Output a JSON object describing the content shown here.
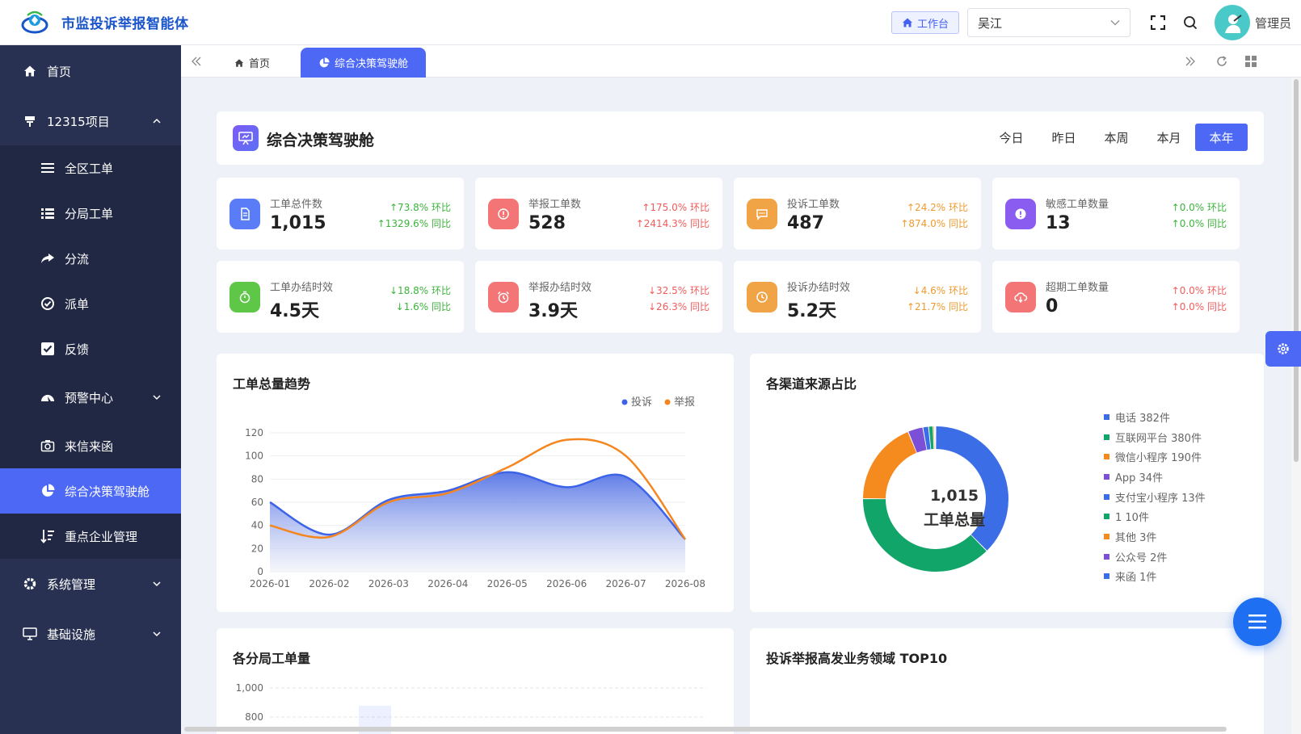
{
  "app": {
    "title": "市监投诉举报智能体"
  },
  "topbar": {
    "workspace_label": "工作台",
    "region_value": "吴江",
    "user_name": "管理员"
  },
  "sidebar": {
    "items": [
      {
        "label": "首页",
        "icon": "home-icon"
      },
      {
        "label": "12315项目",
        "icon": "flag-icon",
        "expanded": true
      },
      {
        "label": "全区工单",
        "icon": "list-icon"
      },
      {
        "label": "分局工单",
        "icon": "grid-list-icon"
      },
      {
        "label": "分流",
        "icon": "share-icon"
      },
      {
        "label": "派单",
        "icon": "check-circle-icon"
      },
      {
        "label": "反馈",
        "icon": "checkbox-icon"
      },
      {
        "label": "预警中心",
        "icon": "dashboard-icon"
      },
      {
        "label": "来信来函",
        "icon": "camera-icon"
      },
      {
        "label": "综合决策驾驶舱",
        "icon": "pie-icon",
        "active": true
      },
      {
        "label": "重点企业管理",
        "icon": "sort-icon"
      },
      {
        "label": "系统管理",
        "icon": "gear-icon"
      },
      {
        "label": "基础设施",
        "icon": "monitor-icon"
      }
    ]
  },
  "tabs": [
    {
      "label": "首页",
      "icon": "home-icon"
    },
    {
      "label": "综合决策驾驶舱",
      "icon": "pie-icon",
      "active": true
    }
  ],
  "dashboard": {
    "title": "综合决策驾驶舱",
    "periods": [
      "今日",
      "昨日",
      "本周",
      "本月",
      "本年"
    ],
    "active_period": "本年"
  },
  "stats": [
    {
      "label": "工单总件数",
      "value": "1,015",
      "mom": "↑73.8% 环比",
      "yoy": "↑1329.6% 同比",
      "icon": "document-icon",
      "icon_color": "#5b7cf7",
      "delta_color": "#3cb33c"
    },
    {
      "label": "举报工单数",
      "value": "528",
      "mom": "↑175.0% 环比",
      "yoy": "↑2414.3% 同比",
      "icon": "alert-circle-icon",
      "icon_color": "#f37575",
      "delta_color": "#ef5c5c"
    },
    {
      "label": "投诉工单数",
      "value": "487",
      "mom": "↑24.2% 环比",
      "yoy": "↑874.0% 同比",
      "icon": "chat-icon",
      "icon_color": "#f1a445",
      "delta_color": "#ef9a2e"
    },
    {
      "label": "敏感工单数量",
      "value": "13",
      "mom": "↑0.0% 环比",
      "yoy": "↑0.0% 同比",
      "icon": "warning-icon",
      "icon_color": "#8a5cf0",
      "delta_color": "#3cb33c"
    },
    {
      "label": "工单办结时效",
      "value": "4.5天",
      "mom": "↓18.8% 环比",
      "yoy": "↓1.6% 同比",
      "icon": "stopwatch-icon",
      "icon_color": "#5ec748",
      "delta_color": "#3cb33c"
    },
    {
      "label": "举报办结时效",
      "value": "3.9天",
      "mom": "↓32.5% 环比",
      "yoy": "↓26.3% 同比",
      "icon": "alarm-clock-icon",
      "icon_color": "#f37575",
      "delta_color": "#ef5c5c"
    },
    {
      "label": "投诉办结时效",
      "value": "5.2天",
      "mom": "↓4.6% 环比",
      "yoy": "↑21.7% 同比",
      "icon": "clock-icon",
      "icon_color": "#f1a445",
      "delta_color": "#ef9a2e"
    },
    {
      "label": "超期工单数量",
      "value": "0",
      "mom": "↑0.0% 环比",
      "yoy": "↑0.0% 同比",
      "icon": "cloud-icon",
      "icon_color": "#f37575",
      "delta_color": "#ef5c5c"
    }
  ],
  "charts": {
    "trend_title": "工单总量趋势",
    "channel_title": "各渠道来源占比",
    "bureau_title": "各分局工单量",
    "top10_title": "投诉举报高发业务领域 TOP10",
    "donut_center_value": "1,015",
    "donut_center_label": "工单总量"
  },
  "chart_data": [
    {
      "type": "area",
      "title": "工单总量趋势",
      "categories": [
        "2026-01",
        "2026-02",
        "2026-03",
        "2026-04",
        "2026-05",
        "2026-06",
        "2026-07",
        "2026-08"
      ],
      "series": [
        {
          "name": "投诉",
          "values": [
            60,
            32,
            62,
            70,
            86,
            73,
            82,
            28
          ],
          "color": "#3d63e8"
        },
        {
          "name": "举报",
          "values": [
            40,
            30,
            60,
            68,
            90,
            114,
            100,
            28
          ],
          "color": "#f5861f"
        }
      ],
      "yticks": [
        0,
        20,
        40,
        60,
        80,
        100,
        120
      ],
      "ylim": [
        0,
        120
      ],
      "legend": "top-right"
    },
    {
      "type": "pie",
      "title": "各渠道来源占比",
      "categories": [
        "电话",
        "互联网平台",
        "微信小程序",
        "App",
        "支付宝小程序",
        "1",
        "其他",
        "公众号",
        "来函"
      ],
      "values": [
        382,
        380,
        190,
        34,
        13,
        10,
        3,
        2,
        1
      ],
      "labels": [
        "电话 382件",
        "互联网平台 380件",
        "微信小程序 190件",
        "App 34件",
        "支付宝小程序 13件",
        "1 10件",
        "其他 3件",
        "公众号 2件",
        "来函 1件"
      ],
      "colors": [
        "#3b6ee6",
        "#12a56a",
        "#f58a1f",
        "#7b4fd6",
        "#3b6ee6",
        "#12a56a",
        "#f58a1f",
        "#7b4fd6",
        "#3b6ee6"
      ],
      "legend": "right"
    },
    {
      "type": "bar",
      "title": "各分局工单量",
      "yticks": [
        "1,000",
        "800"
      ]
    }
  ]
}
